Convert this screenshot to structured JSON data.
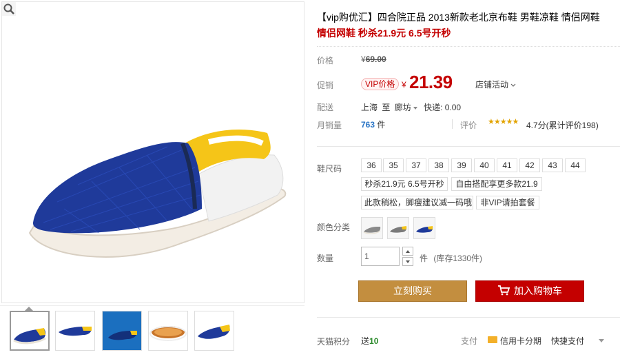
{
  "title": "【vip购优汇】四合院正品 2013新款老北京布鞋 男鞋凉鞋 情侣网鞋",
  "promo": "情侣网鞋 秒杀21.9元 6.5号开秒",
  "price": {
    "label": "价格",
    "currency": "¥",
    "original": "69.00"
  },
  "promotion": {
    "label": "促销",
    "badge": "VIP价格",
    "currency": "¥",
    "current": "21.39",
    "store_activity": "店铺活动"
  },
  "shipping": {
    "label": "配送",
    "from": "上海",
    "to_word": "至",
    "to": "廊坊",
    "fee": "快递: 0.00"
  },
  "sales": {
    "label": "月销量",
    "count": "763",
    "unit": "件"
  },
  "rating": {
    "label": "评价",
    "stars": "★★★★★",
    "value": "4.7分(累计评价198)"
  },
  "size": {
    "label": "鞋尺码",
    "options": [
      "36",
      "35",
      "37",
      "38",
      "39",
      "40",
      "41",
      "42",
      "43",
      "44",
      "秒杀21.9元 6.5号开秒",
      "自由搭配享更多款21.9",
      "此款稍松，脚瘦建议减一码哦",
      "非VIP请拍套餐"
    ]
  },
  "color": {
    "label": "颜色分类",
    "swatches": [
      "gray-shoe",
      "gray-yellow-shoe",
      "blue-yellow-shoe"
    ]
  },
  "quantity": {
    "label": "数量",
    "value": "1",
    "unit": "件",
    "stock": "(库存1330件)"
  },
  "buttons": {
    "buy": "立刻购买",
    "cart": "加入购物车"
  },
  "bottom": {
    "label": "天猫积分",
    "send": "送",
    "points": "10",
    "pay": "支付",
    "card": "信用卡分期",
    "fast": "快捷支付"
  },
  "colors": {
    "price_red": "#c40000",
    "buy_btn": "#c38e3f",
    "cart_btn": "#c40000",
    "shoe_blue": "#1f3a9a",
    "shoe_yellow": "#f5c518"
  }
}
